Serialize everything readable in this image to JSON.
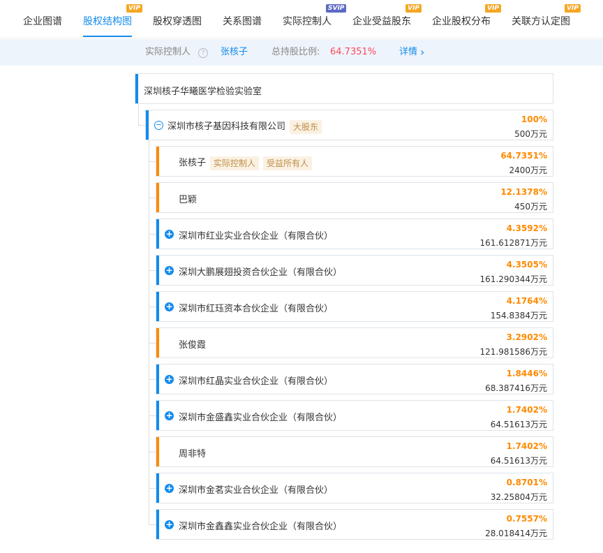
{
  "tabs": [
    {
      "label": "企业图谱",
      "badge": ""
    },
    {
      "label": "股权结构图",
      "badge": "VIP"
    },
    {
      "label": "股权穿透图",
      "badge": ""
    },
    {
      "label": "关系图谱",
      "badge": ""
    },
    {
      "label": "实际控制人",
      "badge": "SVIP"
    },
    {
      "label": "企业受益股东",
      "badge": "VIP"
    },
    {
      "label": "企业股权分布",
      "badge": "VIP"
    },
    {
      "label": "关联方认定图",
      "badge": "VIP"
    }
  ],
  "summary": {
    "controller_label": "实际控制人",
    "info_icon": "?",
    "controller_name": "张核子",
    "ratio_label": "总持股比例:",
    "ratio_value": "64.7351%",
    "detail_link": "详情",
    "detail_arrow": "›"
  },
  "root": {
    "name": "深圳核子华曦医学检验实验室"
  },
  "level1": {
    "name": "深圳市核子基因科技有限公司",
    "tag": "大股东",
    "percent": "100%",
    "amount": "500万元",
    "toggle": "−"
  },
  "shareholders": [
    {
      "name": "张核子",
      "tags": [
        "实际控制人",
        "受益所有人"
      ],
      "percent": "64.7351%",
      "amount": "2400万元",
      "type": "person"
    },
    {
      "name": "巴颖",
      "tags": [],
      "percent": "12.1378%",
      "amount": "450万元",
      "type": "person"
    },
    {
      "name": "深圳市红业实业合伙企业（有限合伙）",
      "tags": [],
      "percent": "4.3592%",
      "amount": "161.612871万元",
      "type": "company"
    },
    {
      "name": "深圳大鹏展翅投资合伙企业（有限合伙）",
      "tags": [],
      "percent": "4.3505%",
      "amount": "161.290344万元",
      "type": "company"
    },
    {
      "name": "深圳市红珏资本合伙企业（有限合伙）",
      "tags": [],
      "percent": "4.1764%",
      "amount": "154.8384万元",
      "type": "company"
    },
    {
      "name": "张俊霞",
      "tags": [],
      "percent": "3.2902%",
      "amount": "121.981586万元",
      "type": "person"
    },
    {
      "name": "深圳市红晶实业合伙企业（有限合伙）",
      "tags": [],
      "percent": "1.8446%",
      "amount": "68.387416万元",
      "type": "company"
    },
    {
      "name": "深圳市金盛鑫实业合伙企业（有限合伙）",
      "tags": [],
      "percent": "1.7402%",
      "amount": "64.51613万元",
      "type": "company"
    },
    {
      "name": "周非特",
      "tags": [],
      "percent": "1.7402%",
      "amount": "64.51613万元",
      "type": "person"
    },
    {
      "name": "深圳市金茗实业合伙企业（有限合伙）",
      "tags": [],
      "percent": "0.8701%",
      "amount": "32.25804万元",
      "type": "company"
    },
    {
      "name": "深圳市金鑫鑫实业合伙企业（有限合伙）",
      "tags": [],
      "percent": "0.7557%",
      "amount": "28.018414万元",
      "type": "company"
    }
  ],
  "expand_symbol": "+",
  "colors": {
    "accent": "#128bed",
    "person_bar": "#ff8a00",
    "percent": "#ff8a00",
    "ratio": "#fd485e"
  }
}
